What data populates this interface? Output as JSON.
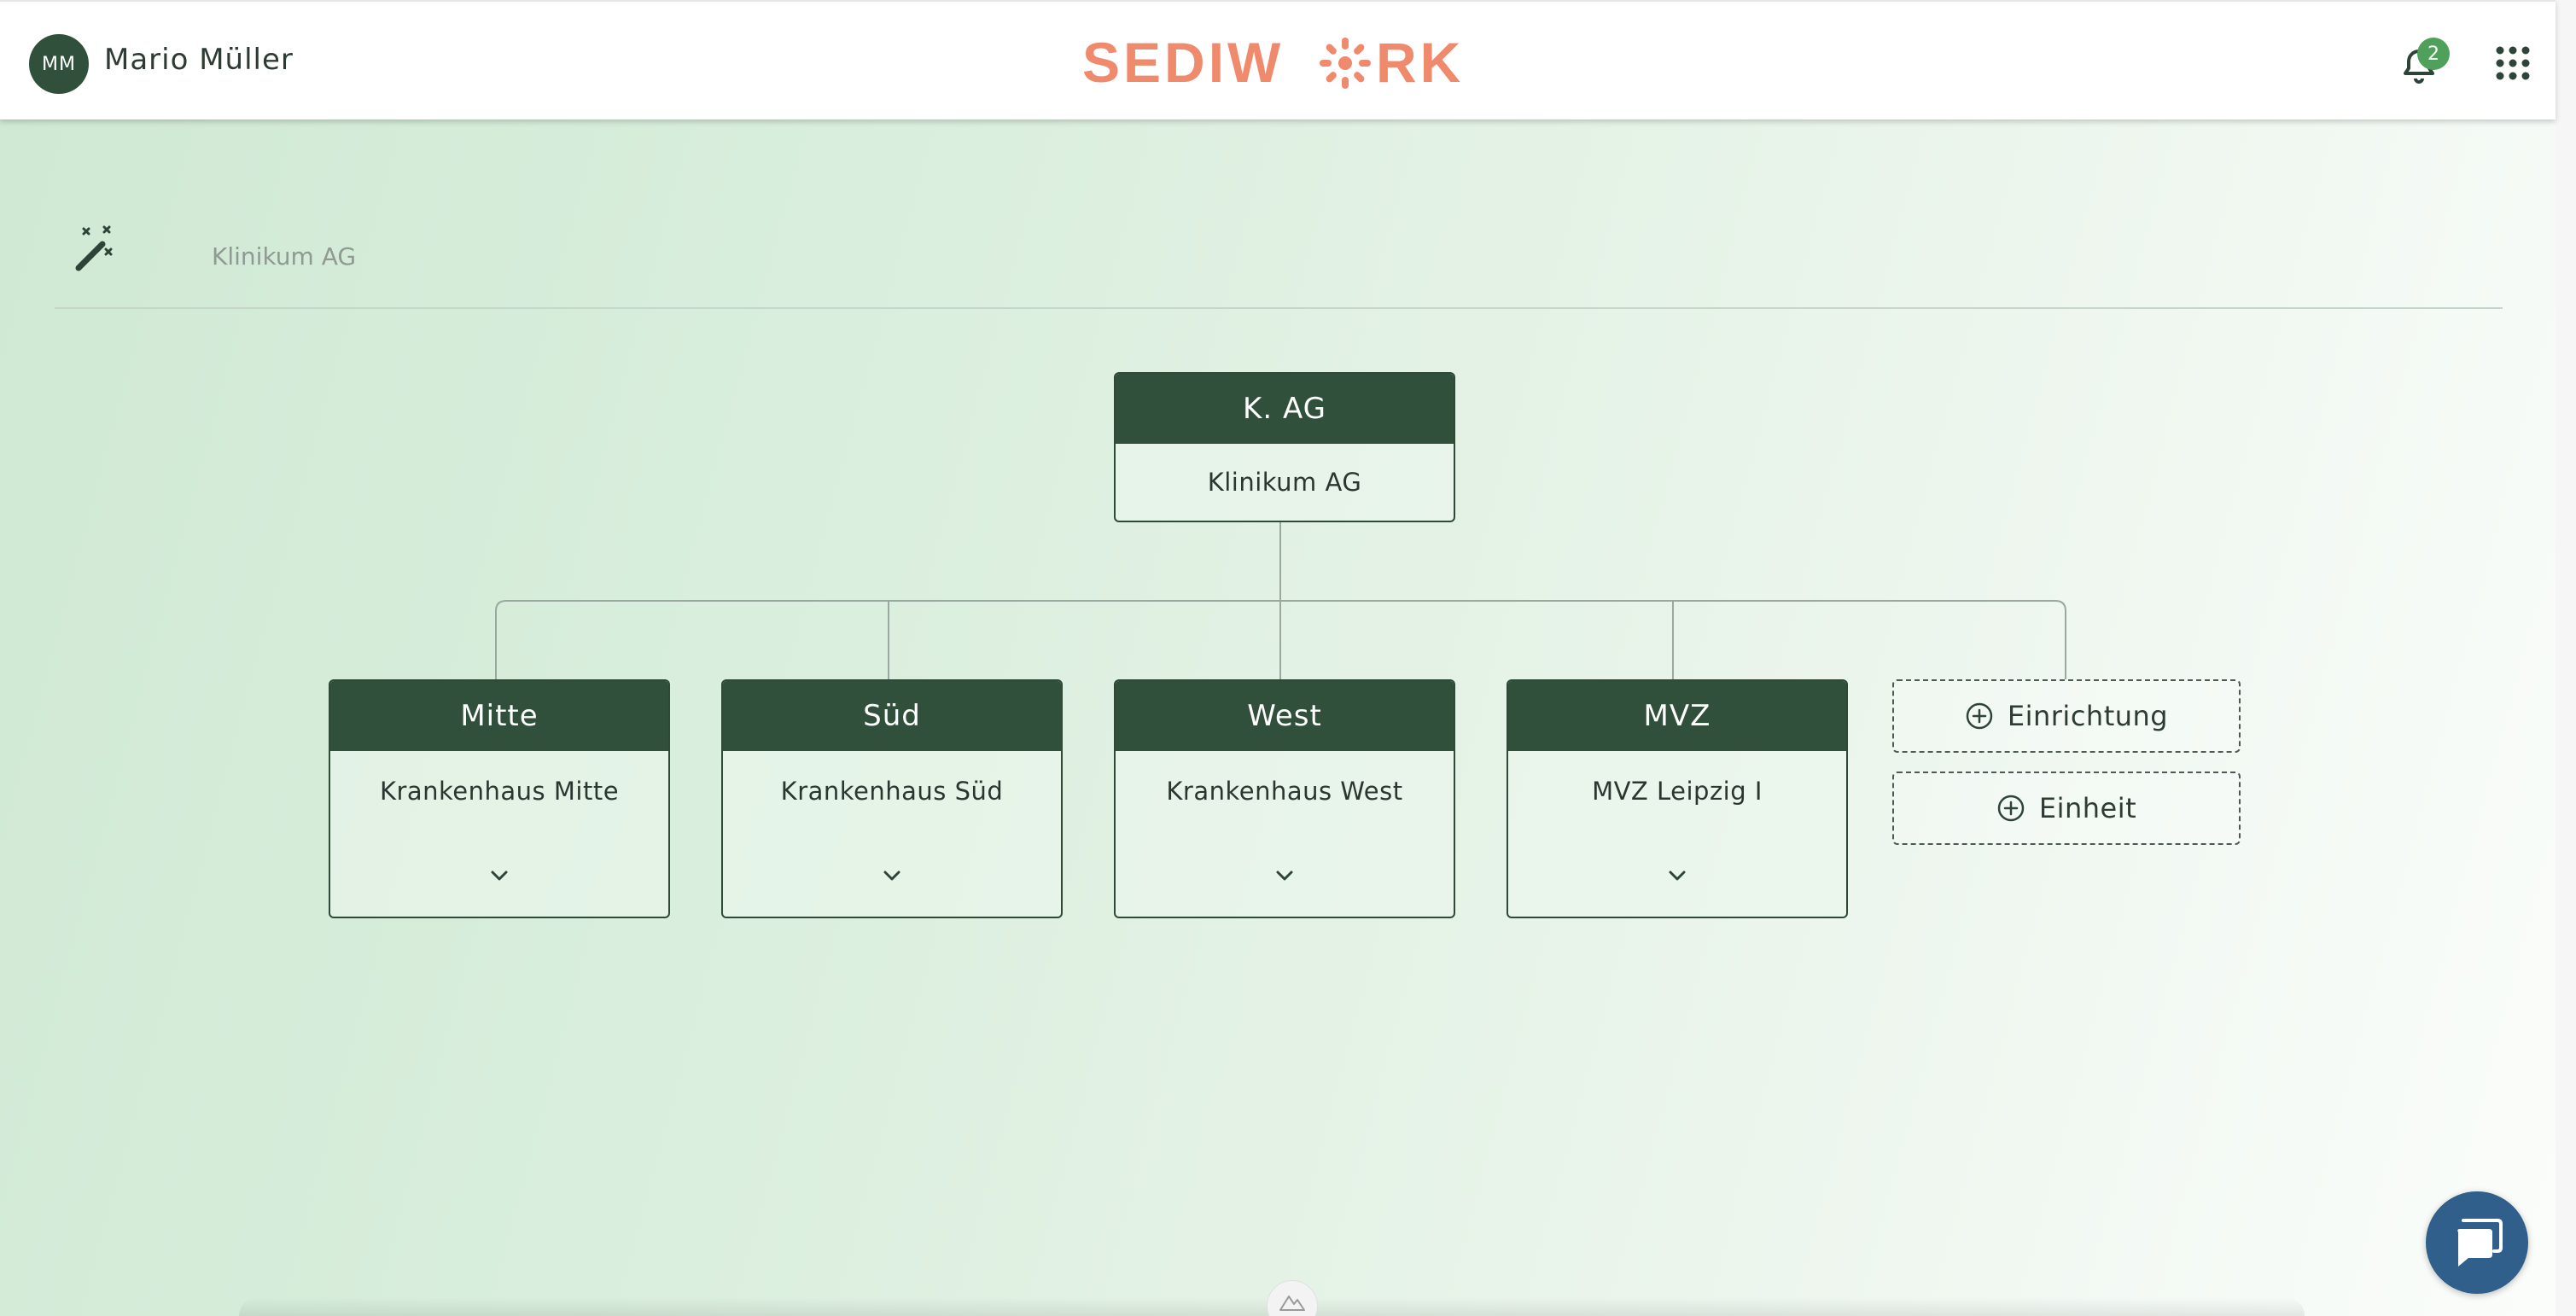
{
  "header": {
    "user_initials": "MM",
    "user_name": "Mario Müller",
    "logo_text": "SEDIWORK",
    "notification_count": "2"
  },
  "breadcrumb": {
    "current": "Klinikum AG"
  },
  "org_root": {
    "short": "K. AG",
    "name": "Klinikum AG"
  },
  "org_children": [
    {
      "short": "Mitte",
      "name": "Krankenhaus Mitte"
    },
    {
      "short": "Süd",
      "name": "Krankenhaus Süd"
    },
    {
      "short": "West",
      "name": "Krankenhaus West"
    },
    {
      "short": "MVZ",
      "name": "MVZ Leipzig I"
    }
  ],
  "add_actions": {
    "facility_label": "Einrichtung",
    "unit_label": "Einheit"
  },
  "icons": {
    "wand": "magic-wand-icon",
    "bell": "bell-icon",
    "apps": "apps-grid-icon",
    "chat": "chat-icon",
    "chevron": "chevron-down-icon",
    "plus": "plus-circle-icon"
  },
  "colors": {
    "node_header": "#30503c",
    "brand_logo": "#ef8a6c",
    "badge": "#4fa05b",
    "chat_button": "#2f5f8a"
  }
}
